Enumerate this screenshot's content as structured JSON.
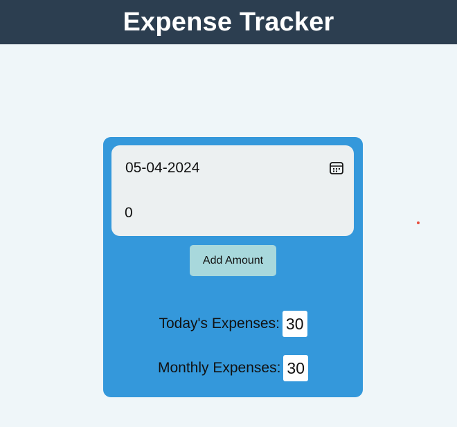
{
  "header": {
    "title": "Expense Tracker"
  },
  "form": {
    "date_value": "05-04-2024",
    "calendar_icon": "calendar-icon",
    "amount_value": "0",
    "add_button_label": "Add Amount"
  },
  "stats": {
    "today_label": "Today's Expenses:",
    "today_value": "30",
    "monthly_label": "Monthly Expenses:",
    "monthly_value": "30"
  },
  "colors": {
    "header_bg": "#2c3e50",
    "card_bg": "#3498db",
    "form_bg": "#ecf0f1",
    "button_bg": "#a8d8dc",
    "page_bg": "#eff6f9"
  }
}
